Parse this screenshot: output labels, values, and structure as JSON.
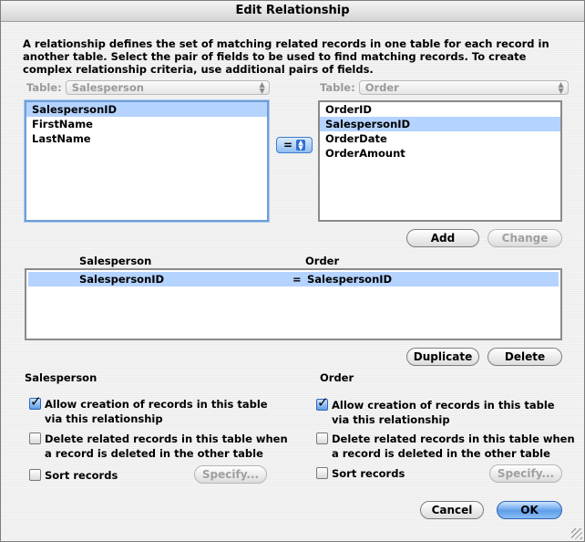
{
  "window": {
    "title": "Edit Relationship"
  },
  "description": "A relationship defines the set of matching related records in one table for each record in another table. Select the pair of fields to be used to find matching records. To create complex relationship criteria, use additional pairs of fields.",
  "left_table": {
    "label": "Table:",
    "value": "Salesperson",
    "fields": [
      "SalespersonID",
      "FirstName",
      "LastName"
    ],
    "selected": "SalespersonID"
  },
  "right_table": {
    "label": "Table:",
    "value": "Order",
    "fields": [
      "OrderID",
      "SalespersonID",
      "OrderDate",
      "OrderAmount"
    ],
    "selected": "SalespersonID"
  },
  "operator": "=",
  "buttons": {
    "add": "Add",
    "change": "Change",
    "duplicate": "Duplicate",
    "delete": "Delete",
    "cancel": "Cancel",
    "ok": "OK",
    "specify": "Specify..."
  },
  "relationship_list": {
    "headers": [
      "Salesperson",
      "Order"
    ],
    "rows": [
      {
        "left": "SalespersonID",
        "op": "=",
        "right": "SalespersonID"
      }
    ]
  },
  "left_options": {
    "title": "Salesperson",
    "allow_create": {
      "line1": "Allow creation of records in this table",
      "line2": "via this relationship",
      "checked": true
    },
    "delete_related": {
      "line1": "Delete related records in this table when",
      "line2": "a record is deleted in the other table",
      "checked": false
    },
    "sort": {
      "label": "Sort records",
      "checked": false
    }
  },
  "right_options": {
    "title": "Order",
    "allow_create": {
      "line1": "Allow creation of records in this table",
      "line2": "via this relationship",
      "checked": true
    },
    "delete_related": {
      "line1": "Delete related records in this table when",
      "line2": "a record is deleted in the other table",
      "checked": false
    },
    "sort": {
      "label": "Sort records",
      "checked": false
    }
  },
  "colors": {
    "selection": "#b5d3ff",
    "default_button": "#5e9ee8"
  }
}
